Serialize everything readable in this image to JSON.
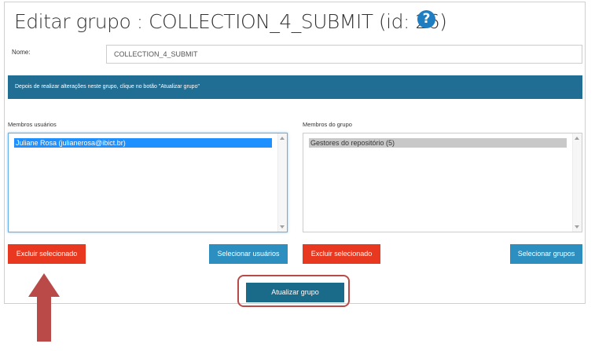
{
  "page": {
    "title": "Editar grupo : COLLECTION_4_SUBMIT (id: 26)",
    "help_icon": "question-circle-icon"
  },
  "form": {
    "name_label": "Nome:",
    "name_value": "COLLECTION_4_SUBMIT"
  },
  "alert": {
    "text": "Depois de realizar alterações neste grupo, clique no botão \"Atualizar grupo\""
  },
  "members_users": {
    "label": "Membros usuários",
    "items": [
      "Juliane Rosa (julianerosa@ibict.br)"
    ],
    "delete_button": "Excluir selecionado",
    "select_button": "Selecionar usuários"
  },
  "members_groups": {
    "label": "Membros do grupo",
    "items": [
      "Gestores do repositório (5)"
    ],
    "delete_button": "Excluir selecionado",
    "select_button": "Selecionar grupos"
  },
  "actions": {
    "update_button": "Atualizar grupo"
  },
  "annotations": {
    "highlight_color": "#b94a48",
    "arrow_color": "#b94a48",
    "arrow_icon": "up-arrow-icon"
  },
  "colors": {
    "danger": "#e8381f",
    "info": "#2c8fbf",
    "primary": "#1a6b8a",
    "alert_bg": "#216e94",
    "help_icon": "#1f7dc2"
  }
}
